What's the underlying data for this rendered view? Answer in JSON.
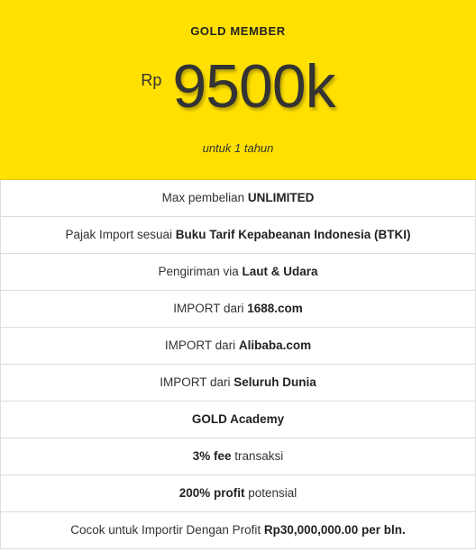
{
  "plan": {
    "tier": "GOLD MEMBER",
    "currency": "Rp",
    "amount": "9500k",
    "period": "untuk 1 tahun",
    "accent_color": "#ffe000"
  },
  "features": [
    {
      "pre": "Max pembelian ",
      "bold": "UNLIMITED",
      "post": ""
    },
    {
      "pre": "Pajak Import sesuai ",
      "bold": "Buku Tarif Kepabeanan Indonesia (BTKI)",
      "post": ""
    },
    {
      "pre": "Pengiriman via ",
      "bold": "Laut & Udara",
      "post": ""
    },
    {
      "pre": "IMPORT dari ",
      "bold": "1688.com",
      "post": ""
    },
    {
      "pre": "IMPORT dari ",
      "bold": "Alibaba.com",
      "post": ""
    },
    {
      "pre": "IMPORT dari ",
      "bold": "Seluruh Dunia",
      "post": ""
    },
    {
      "pre": "",
      "bold": "GOLD Academy",
      "post": ""
    },
    {
      "pre": "",
      "bold": "3% fee",
      "post": " transaksi"
    },
    {
      "pre": "",
      "bold": "200% profit",
      "post": " potensial"
    },
    {
      "pre": "Cocok untuk Importir Dengan Profit ",
      "bold": "Rp30,000,000.00 per bln.",
      "post": ""
    }
  ]
}
